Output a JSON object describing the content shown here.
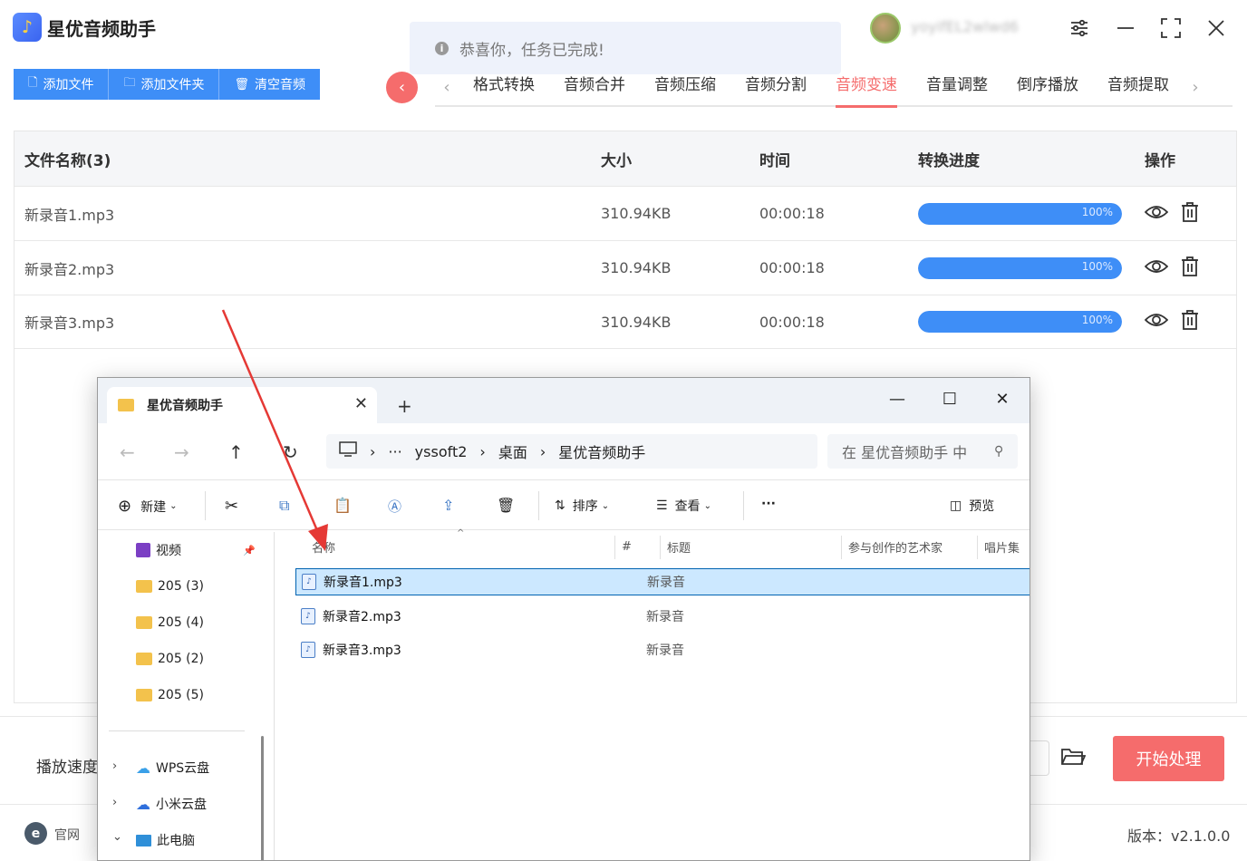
{
  "app": {
    "title": "星优音频助手",
    "user_name": "yoyifEL2wlwd6",
    "toast": "恭喜你，任务已完成!"
  },
  "toolbar": {
    "add_file": "添加文件",
    "add_folder": "添加文件夹",
    "clear": "清空音频"
  },
  "tabs": [
    "格式转换",
    "音频合并",
    "音频压缩",
    "音频分割",
    "音频变速",
    "音量调整",
    "倒序播放",
    "音频提取"
  ],
  "table": {
    "headers": {
      "name": "文件名称(3)",
      "size": "大小",
      "time": "时间",
      "progress": "转换进度",
      "ops": "操作"
    },
    "rows": [
      {
        "name": "新录音1.mp3",
        "size": "310.94KB",
        "time": "00:00:18",
        "progress_text": "100%",
        "progress": 1.0
      },
      {
        "name": "新录音2.mp3",
        "size": "310.94KB",
        "time": "00:00:18",
        "progress_text": "100%",
        "progress": 1.0
      },
      {
        "name": "新录音3.mp3",
        "size": "310.94KB",
        "time": "00:00:18",
        "progress_text": "100%",
        "progress": 1.0
      }
    ]
  },
  "bottom": {
    "speed_label": "播放速度",
    "start_button": "开始处理",
    "site_label": "官网",
    "version": "版本：v2.1.0.0"
  },
  "explorer": {
    "tab_title": "星优音频助手",
    "breadcrumb": [
      "yssoft2",
      "桌面",
      "星优音频助手"
    ],
    "breadcrumb_more": "···",
    "search_placeholder": "在 星优音频助手 中",
    "commands": {
      "new": "新建",
      "sort": "排序",
      "view": "查看",
      "more": "···",
      "preview": "预览"
    },
    "nav": {
      "quick": [
        {
          "label": "视频",
          "type": "video"
        },
        {
          "label": "205 (3)",
          "type": "folder"
        },
        {
          "label": "205 (4)",
          "type": "folder"
        },
        {
          "label": "205 (2)",
          "type": "folder"
        },
        {
          "label": "205 (5)",
          "type": "folder"
        }
      ],
      "drives": [
        {
          "label": "WPS云盘",
          "chev": "›"
        },
        {
          "label": "小米云盘",
          "chev": "›"
        },
        {
          "label": "此电脑",
          "chev": "⌄"
        }
      ]
    },
    "columns": {
      "name": "名称",
      "num": "#",
      "title": "标题",
      "artist": "参与创作的艺术家",
      "album": "唱片集"
    },
    "files": [
      {
        "name": "新录音1.mp3",
        "title": "新录音",
        "selected": true
      },
      {
        "name": "新录音2.mp3",
        "title": "新录音",
        "selected": false
      },
      {
        "name": "新录音3.mp3",
        "title": "新录音",
        "selected": false
      }
    ]
  },
  "colors": {
    "accent_blue": "#3e8ef7",
    "accent_red": "#f56c6c",
    "selection": "#cce8ff"
  }
}
